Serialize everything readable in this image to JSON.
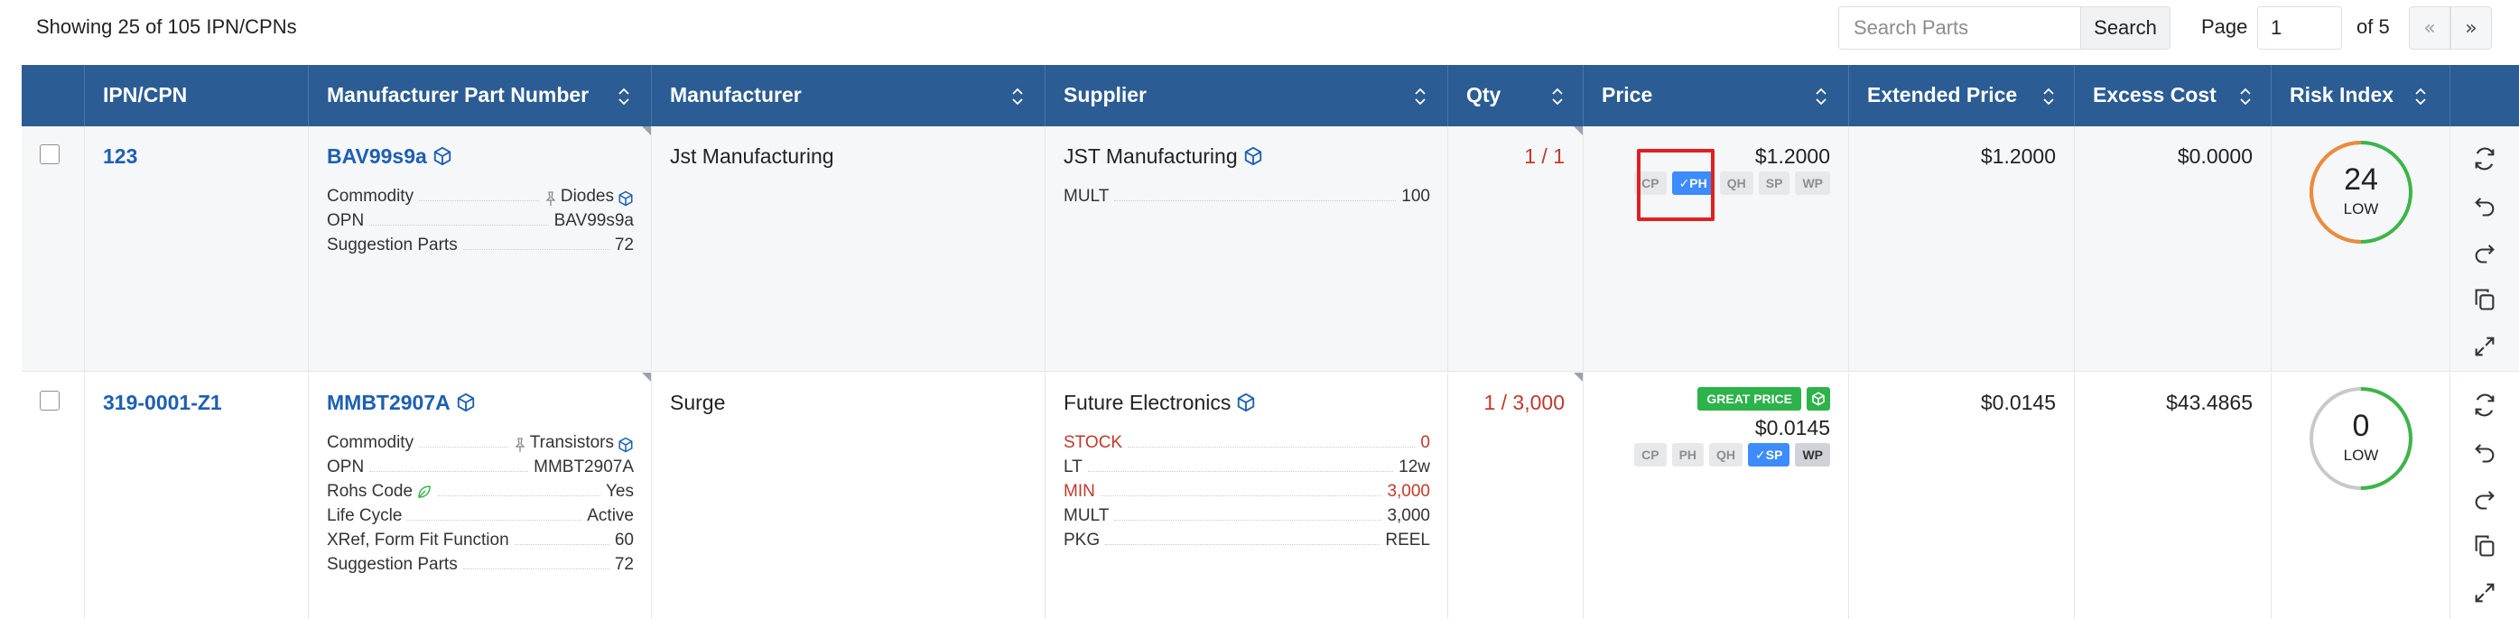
{
  "toolbar": {
    "showing_text": "Showing 25 of 105 IPN/CPNs",
    "search_placeholder": "Search Parts",
    "search_button": "Search",
    "page_label": "Page",
    "page_value": "1",
    "of_label": "of 5",
    "prev_label": "«",
    "next_label": "»"
  },
  "columns": [
    {
      "label": ""
    },
    {
      "label": "IPN/CPN"
    },
    {
      "label": "Manufacturer Part Number"
    },
    {
      "label": "Manufacturer"
    },
    {
      "label": "Supplier"
    },
    {
      "label": "Qty"
    },
    {
      "label": "Price"
    },
    {
      "label": "Extended Price"
    },
    {
      "label": "Excess Cost"
    },
    {
      "label": "Risk Index"
    },
    {
      "label": ""
    }
  ],
  "rows": [
    {
      "ipn": "123",
      "mpn": "BAV99s9a",
      "mpn_details": [
        {
          "key": "Commodity",
          "value": "Diodes"
        },
        {
          "key": "OPN",
          "value": "BAV99s9a"
        },
        {
          "key": "Suggestion Parts",
          "value": "72"
        }
      ],
      "manufacturer": "Jst Manufacturing",
      "supplier": "JST Manufacturing",
      "supplier_details": [
        {
          "key": "MULT",
          "value": "100"
        }
      ],
      "qty": "1 / 1",
      "price": "$1.2000",
      "price_tags": [
        "CP",
        "PH",
        "QH",
        "SP",
        "WP"
      ],
      "active_tag": "PH",
      "extended_price": "$1.2000",
      "excess_cost": "$0.0000",
      "risk_value": "24",
      "risk_label": "LOW"
    },
    {
      "ipn": "319-0001-Z1",
      "mpn": "MMBT2907A",
      "mpn_details": [
        {
          "key": "Commodity",
          "value": "Transistors"
        },
        {
          "key": "OPN",
          "value": "MMBT2907A"
        },
        {
          "key": "Rohs Code",
          "value": "Yes"
        },
        {
          "key": "Life Cycle",
          "value": "Active"
        },
        {
          "key": "XRef, Form Fit Function",
          "value": "60"
        },
        {
          "key": "Suggestion Parts",
          "value": "72"
        }
      ],
      "manufacturer": "Surge",
      "supplier": "Future Electronics",
      "supplier_details": [
        {
          "key": "STOCK",
          "value": "0"
        },
        {
          "key": "LT",
          "value": "12w"
        },
        {
          "key": "MIN",
          "value": "3,000"
        },
        {
          "key": "MULT",
          "value": "3,000"
        },
        {
          "key": "PKG",
          "value": "REEL"
        }
      ],
      "qty": "1 / 3,000",
      "great_price_label": "GREAT PRICE",
      "price": "$0.0145",
      "price_tags": [
        "CP",
        "PH",
        "QH",
        "SP",
        "WP"
      ],
      "active_tag": "SP",
      "extended_price": "$0.0145",
      "excess_cost": "$43.4865",
      "risk_value": "0",
      "risk_label": "LOW"
    }
  ],
  "colors": {
    "header_bg": "#2b5c93",
    "link": "#1d5fb3",
    "qty_red": "#c0392b",
    "active_tag": "#3d8bfd",
    "great_price": "#2cb34a",
    "risk_green": "#3cb54a",
    "risk_orange": "#f08a3c",
    "highlight": "#e02020"
  },
  "icons": [
    "cube-icon",
    "sort-icon",
    "refresh-icon",
    "undo-icon",
    "redo-icon",
    "copy-icon",
    "expand-icon",
    "check-icon",
    "leaf-icon",
    "pin-icon"
  ]
}
